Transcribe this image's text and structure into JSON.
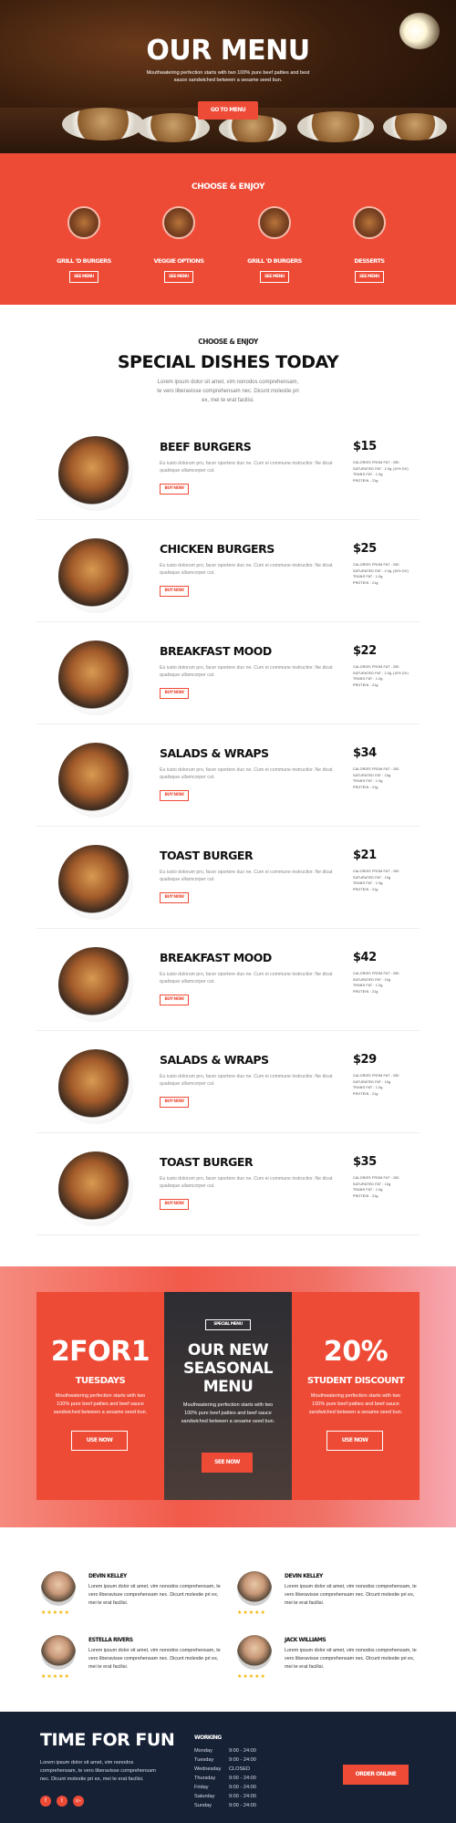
{
  "hero": {
    "title": "OUR MENU",
    "subtitle": "Mouthwatering perfection starts with two 100% pure beef patties and best sauce sandwiched between a sesame seed bun.",
    "button": "GO TO MENU"
  },
  "choose": {
    "title": "CHOOSE & ENJOY",
    "categories": [
      {
        "label": "GRILL 'D BURGERS",
        "button": "SEE MENU"
      },
      {
        "label": "VEGGIE OPTIONS",
        "button": "SEE MENU"
      },
      {
        "label": "GRILL 'D BURGERS",
        "button": "SEE MENU"
      },
      {
        "label": "DESSERTS",
        "button": "SEE MENU"
      }
    ]
  },
  "specials": {
    "eyebrow": "CHOOSE & ENJOY",
    "title": "SPECIAL DISHES TODAY",
    "description": "Lorem ipsum dolor sit amet, vim nonodos comprehensam, te vero liberavisse comprehensam nec. Dicunt molestie pri ex, mei te erat facilisi.",
    "buy_label": "BUY NOW",
    "items": [
      {
        "name": "BEEF BURGERS",
        "price": "$15",
        "desc": "Eu iusto dolorum pro, facer oportere duo ne. Cum ei commune instructior. Ne dicat qualisque ullamcorper cut.",
        "nutrition": [
          "CALORIES FROM FAT : 250",
          "SATURATED FAT : 2.0g (10% DV)",
          "TRANS FAT : 1.0g",
          "PROTEIN : 21g"
        ]
      },
      {
        "name": "CHICKEN BURGERS",
        "price": "$25",
        "desc": "Eu iusto dolorum pro, facer oportere duo ne. Cum ei commune instructior. Ne dicat qualisque ullamcorper cut.",
        "nutrition": [
          "CALORIES FROM FAT : 250",
          "SATURATED FAT : 2.0g (10% DV)",
          "TRANS FAT : 1.0g",
          "PROTEIN : 21g"
        ]
      },
      {
        "name": "BREAKFAST MOOD",
        "price": "$22",
        "desc": "Eu iusto dolorum pro, facer oportere duo ne. Cum ei commune instructior. Ne dicat qualisque ullamcorper cut.",
        "nutrition": [
          "CALORIES FROM FAT : 250",
          "SATURATED FAT : 2.0g (10% DV)",
          "TRANS FAT : 1.0g",
          "PROTEIN : 21g"
        ]
      },
      {
        "name": "SALADS & WRAPS",
        "price": "$34",
        "desc": "Eu iusto dolorum pro, facer oportere duo ne. Cum ei commune instructior. Ne dicat qualisque ullamcorper cut.",
        "nutrition": [
          "CALORIES FROM FAT : 250",
          "SATURATED FAT : 10g",
          "TRANS FAT : 1.0g",
          "PROTEIN : 21g"
        ]
      },
      {
        "name": "TOAST BURGER",
        "price": "$21",
        "desc": "Eu iusto dolorum pro, facer oportere duo ne. Cum ei commune instructior. Ne dicat qualisque ullamcorper cut.",
        "nutrition": [
          "CALORIES FROM FAT : 250",
          "SATURATED FAT : 10g",
          "TRANS FAT : 1.0g",
          "PROTEIN : 21g"
        ]
      },
      {
        "name": "BREAKFAST MOOD",
        "price": "$42",
        "desc": "Eu iusto dolorum pro, facer oportere duo ne. Cum ei commune instructior. Ne dicat qualisque ullamcorper cut.",
        "nutrition": [
          "CALORIES FROM FAT : 250",
          "SATURATED FAT : 10g",
          "TRANS FAT : 1.0g",
          "PROTEIN : 21g"
        ]
      },
      {
        "name": "SALADS & WRAPS",
        "price": "$29",
        "desc": "Eu iusto dolorum pro, facer oportere duo ne. Cum ei commune instructior. Ne dicat qualisque ullamcorper cut.",
        "nutrition": [
          "CALORIES FROM FAT : 250",
          "SATURATED FAT : 10g",
          "TRANS FAT : 1.0g",
          "PROTEIN : 21g"
        ]
      },
      {
        "name": "TOAST BURGER",
        "price": "$35",
        "desc": "Eu iusto dolorum pro, facer oportere duo ne. Cum ei commune instructior. Ne dicat qualisque ullamcorper cut.",
        "nutrition": [
          "CALORIES FROM FAT : 250",
          "SATURATED FAT : 10g",
          "TRANS FAT : 1.0g",
          "PROTEIN : 21g"
        ]
      }
    ]
  },
  "promo": {
    "left": {
      "big": "2FOR1",
      "mid": "TUESDAYS",
      "text": "Mouthwatering perfection starts with two 100% pure beef patties and beef sauce sandwiched between a sesame seed bun.",
      "button": "USE NOW"
    },
    "center": {
      "tag": "SPECIAL MENU",
      "title": "OUR NEW SEASONAL MENU",
      "text": "Mouthwatering perfection starts with two 100% pure beef patties and beef sauce sandwiched between a sesame seed bun.",
      "button": "SEE NOW"
    },
    "right": {
      "big": "20%",
      "mid": "STUDENT DISCOUNT",
      "text": "Mouthwatering perfection starts with two 100% pure beef patties and beef sauce sandwiched between a sesame seed bun.",
      "button": "USE NOW"
    }
  },
  "testimonials": [
    {
      "name": "DEVIN KELLEY",
      "text": "Lorem ipsum dolor sit amet, vim nonodos comprehensam, te vero liberavisse comprehensam nec. Dicunt molestie pri ex, mei te erat facilisi.",
      "stars": "★★★★★"
    },
    {
      "name": "DEVIN KELLEY",
      "text": "Lorem ipsum dolor sit amet, vim nonodos comprehensam, te vero liberavisse comprehensam nec. Dicunt molestie pri ex, mei te erat facilisi.",
      "stars": "★★★★★"
    },
    {
      "name": "ESTELLA RIVERS",
      "text": "Lorem ipsum dolor sit amet, vim nonodos comprehensam, te vero liberavisse comprehensam nec. Dicunt molestie pri ex, mei te erat facilisi.",
      "stars": "★★★★★"
    },
    {
      "name": "JACK WILLIAMS",
      "text": "Lorem ipsum dolor sit amet, vim nonodos comprehensam, te vero liberavisse comprehensam nec. Dicunt molestie pri ex, mei te erat facilisi.",
      "stars": "★★★★★"
    }
  ],
  "footer": {
    "title": "TIME FOR FUN",
    "description": "Lorem ipsum dolor sit amet, vim nonodos comprehensam, te vero liberavisse comprehensam nec. Dicunt molestie pri ex, mei te erat facilisi.",
    "social": [
      "f",
      "t",
      "G+"
    ],
    "working_title": "WORKING",
    "hours": [
      {
        "day": "Monday",
        "time": "9:00 - 24:00"
      },
      {
        "day": "Tuesday",
        "time": "9:00 - 24:00"
      },
      {
        "day": "Wednesday",
        "time": "CLOSED"
      },
      {
        "day": "Thursday",
        "time": "9:00 - 24:00"
      },
      {
        "day": "Friday",
        "time": "9:00 - 24:00"
      },
      {
        "day": "Saturday",
        "time": "9:00 - 24:00"
      },
      {
        "day": "Sunday",
        "time": "9:00 - 24:00"
      }
    ],
    "order_button": "ORDER ONLINE"
  },
  "colors": {
    "accent": "#ee4b37",
    "footer_bg": "#162136",
    "star": "#f5b400"
  }
}
